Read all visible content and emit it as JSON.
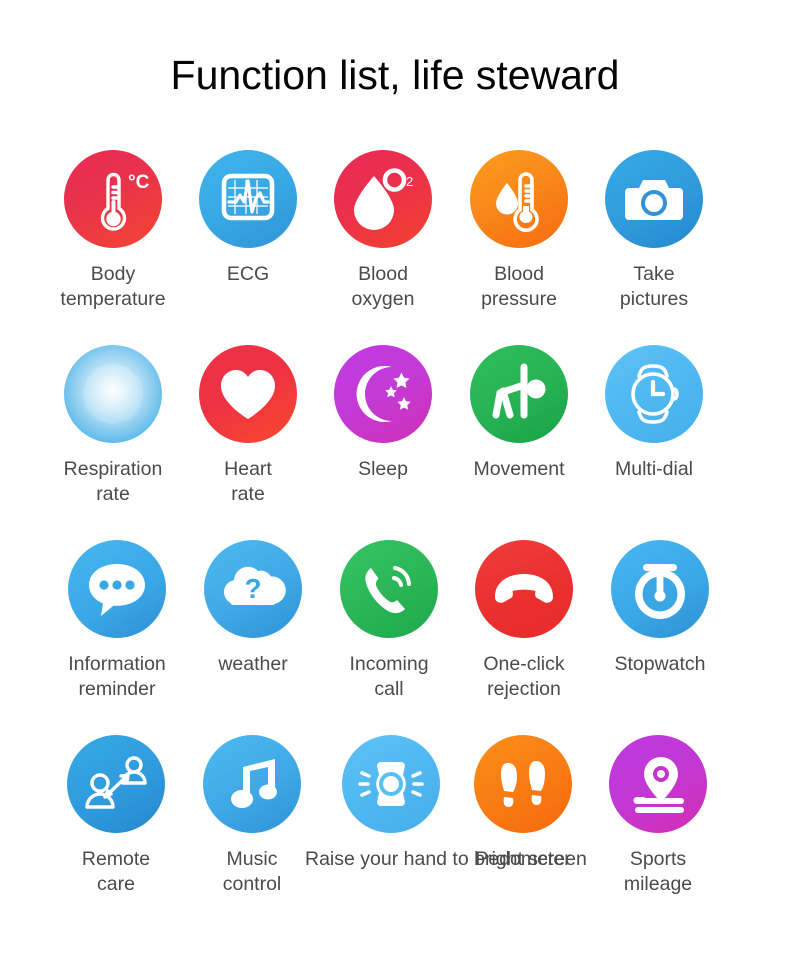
{
  "page": {
    "title": "Function list, life steward",
    "background": "#ffffff",
    "text_color": "#4b4b4b",
    "title_color": "#050505"
  },
  "grid": {
    "columns": 5,
    "rows": 4,
    "items": [
      {
        "label": "Body\ntemperature",
        "icon": "thermometer-celsius-icon",
        "color": "#ec2c52",
        "color2": "#f4452f"
      },
      {
        "label": "ECG",
        "icon": "ecg-monitor-icon",
        "color": "#41b3ec",
        "color2": "#2f93d6"
      },
      {
        "label": "Blood\noxygen",
        "icon": "blood-drop-o2-icon",
        "color": "#ec2a55",
        "color2": "#f5412e"
      },
      {
        "label": "Blood\npressure",
        "icon": "blood-pressure-thermometer-icon",
        "color": "#fb9e1b",
        "color2": "#f76b0d"
      },
      {
        "label": "Take\npictures",
        "icon": "camera-icon",
        "color": "#36a9e6",
        "color2": "#2487cd"
      },
      {
        "label": "Respiration\nrate",
        "icon": "respiration-glow-icon",
        "color": "#49b2e9",
        "color2": "#ffffff"
      },
      {
        "label": "Heart\nrate",
        "icon": "heart-icon",
        "color": "#ef3148",
        "color2": "#f8492d"
      },
      {
        "label": "Sleep",
        "icon": "moon-stars-icon",
        "color": "#c13ae0",
        "color2": "#d02fb5"
      },
      {
        "label": "Movement",
        "icon": "exercise-person-icon",
        "color": "#2fbd5e",
        "color2": "#17a246"
      },
      {
        "label": "Multi-dial",
        "icon": "watch-clock-icon",
        "color": "#5cc3f5",
        "color2": "#45aeea"
      },
      {
        "label": "Information\nreminder",
        "icon": "chat-bubble-dots-icon",
        "color": "#47b7f0",
        "color2": "#2e8fd2"
      },
      {
        "label": "weather",
        "icon": "cloud-question-icon",
        "color": "#4dbaf0",
        "color2": "#2f93d6"
      },
      {
        "label": "Incoming\ncall",
        "icon": "incoming-call-icon",
        "color": "#35c464",
        "color2": "#1da84b"
      },
      {
        "label": "One-click\nrejection",
        "icon": "call-reject-icon",
        "color": "#ef3d3d",
        "color2": "#e82a2a"
      },
      {
        "label": "Stopwatch",
        "icon": "stopwatch-icon",
        "color": "#47b7f0",
        "color2": "#2e8fd2"
      },
      {
        "label": "Remote\ncare",
        "icon": "remote-care-people-icon",
        "color": "#36a9e6",
        "color2": "#2487cd"
      },
      {
        "label": "Music\ncontrol",
        "icon": "music-note-icon",
        "color": "#4dbaf0",
        "color2": "#2f93d6"
      },
      {
        "label": "Raise your hand\nto bright screen",
        "icon": "raise-hand-watch-icon",
        "color": "#5cc3f5",
        "color2": "#45aeea"
      },
      {
        "label": "Pedometer",
        "icon": "footprints-icon",
        "color": "#fb8f18",
        "color2": "#f56a0a"
      },
      {
        "label": "Sports\nmileage",
        "icon": "location-pin-road-icon",
        "color": "#bb3ae0",
        "color2": "#d42db0"
      }
    ]
  }
}
